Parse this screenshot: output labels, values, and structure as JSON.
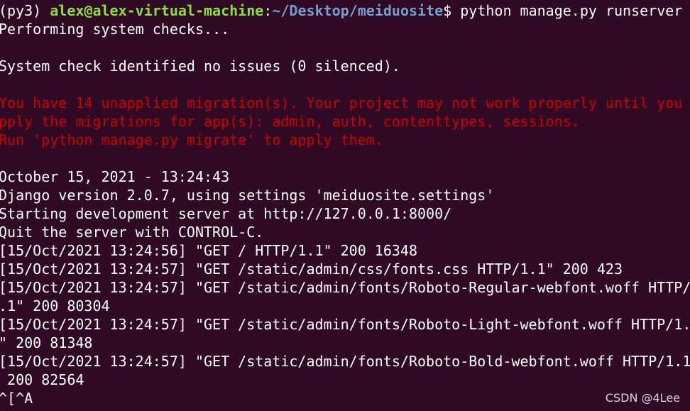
{
  "prompt": {
    "env": "(py3) ",
    "user_host": "alex@alex-virtual-machine",
    "sep": ":",
    "path": "~/Desktop/meiduosite",
    "symbol": "$ ",
    "command": "python manage.py runserver"
  },
  "output": [
    {
      "text": "Performing system checks...",
      "style": "plain"
    },
    {
      "text": "",
      "style": "plain"
    },
    {
      "text": "System check identified no issues (0 silenced).",
      "style": "plain"
    },
    {
      "text": "",
      "style": "plain"
    },
    {
      "text": "You have 14 unapplied migration(s). Your project may not work properly until you a",
      "style": "warn"
    },
    {
      "text": "pply the migrations for app(s): admin, auth, contenttypes, sessions.",
      "style": "warn"
    },
    {
      "text": "Run 'python manage.py migrate' to apply them.",
      "style": "warn"
    },
    {
      "text": "",
      "style": "plain"
    },
    {
      "text": "October 15, 2021 - 13:24:43",
      "style": "plain"
    },
    {
      "text": "Django version 2.0.7, using settings 'meiduosite.settings'",
      "style": "plain"
    },
    {
      "text": "Starting development server at http://127.0.0.1:8000/",
      "style": "plain"
    },
    {
      "text": "Quit the server with CONTROL-C.",
      "style": "plain"
    },
    {
      "text": "[15/Oct/2021 13:24:56] \"GET / HTTP/1.1\" 200 16348",
      "style": "plain"
    },
    {
      "text": "[15/Oct/2021 13:24:57] \"GET /static/admin/css/fonts.css HTTP/1.1\" 200 423",
      "style": "plain"
    },
    {
      "text": "[15/Oct/2021 13:24:57] \"GET /static/admin/fonts/Roboto-Regular-webfont.woff HTTP/1",
      "style": "plain"
    },
    {
      "text": ".1\" 200 80304",
      "style": "plain"
    },
    {
      "text": "[15/Oct/2021 13:24:57] \"GET /static/admin/fonts/Roboto-Light-webfont.woff HTTP/1.1",
      "style": "plain"
    },
    {
      "text": "\" 200 81348",
      "style": "plain"
    },
    {
      "text": "[15/Oct/2021 13:24:57] \"GET /static/admin/fonts/Roboto-Bold-webfont.woff HTTP/1.1\"",
      "style": "plain"
    },
    {
      "text": " 200 82564",
      "style": "plain"
    },
    {
      "text": "^[^A",
      "style": "plain"
    }
  ],
  "watermark": "CSDN @4Lee",
  "colors": {
    "background": "#300a24",
    "text": "#ffffff",
    "user_host": "#8ae234",
    "path": "#729fcf",
    "warning": "#cc0000"
  }
}
